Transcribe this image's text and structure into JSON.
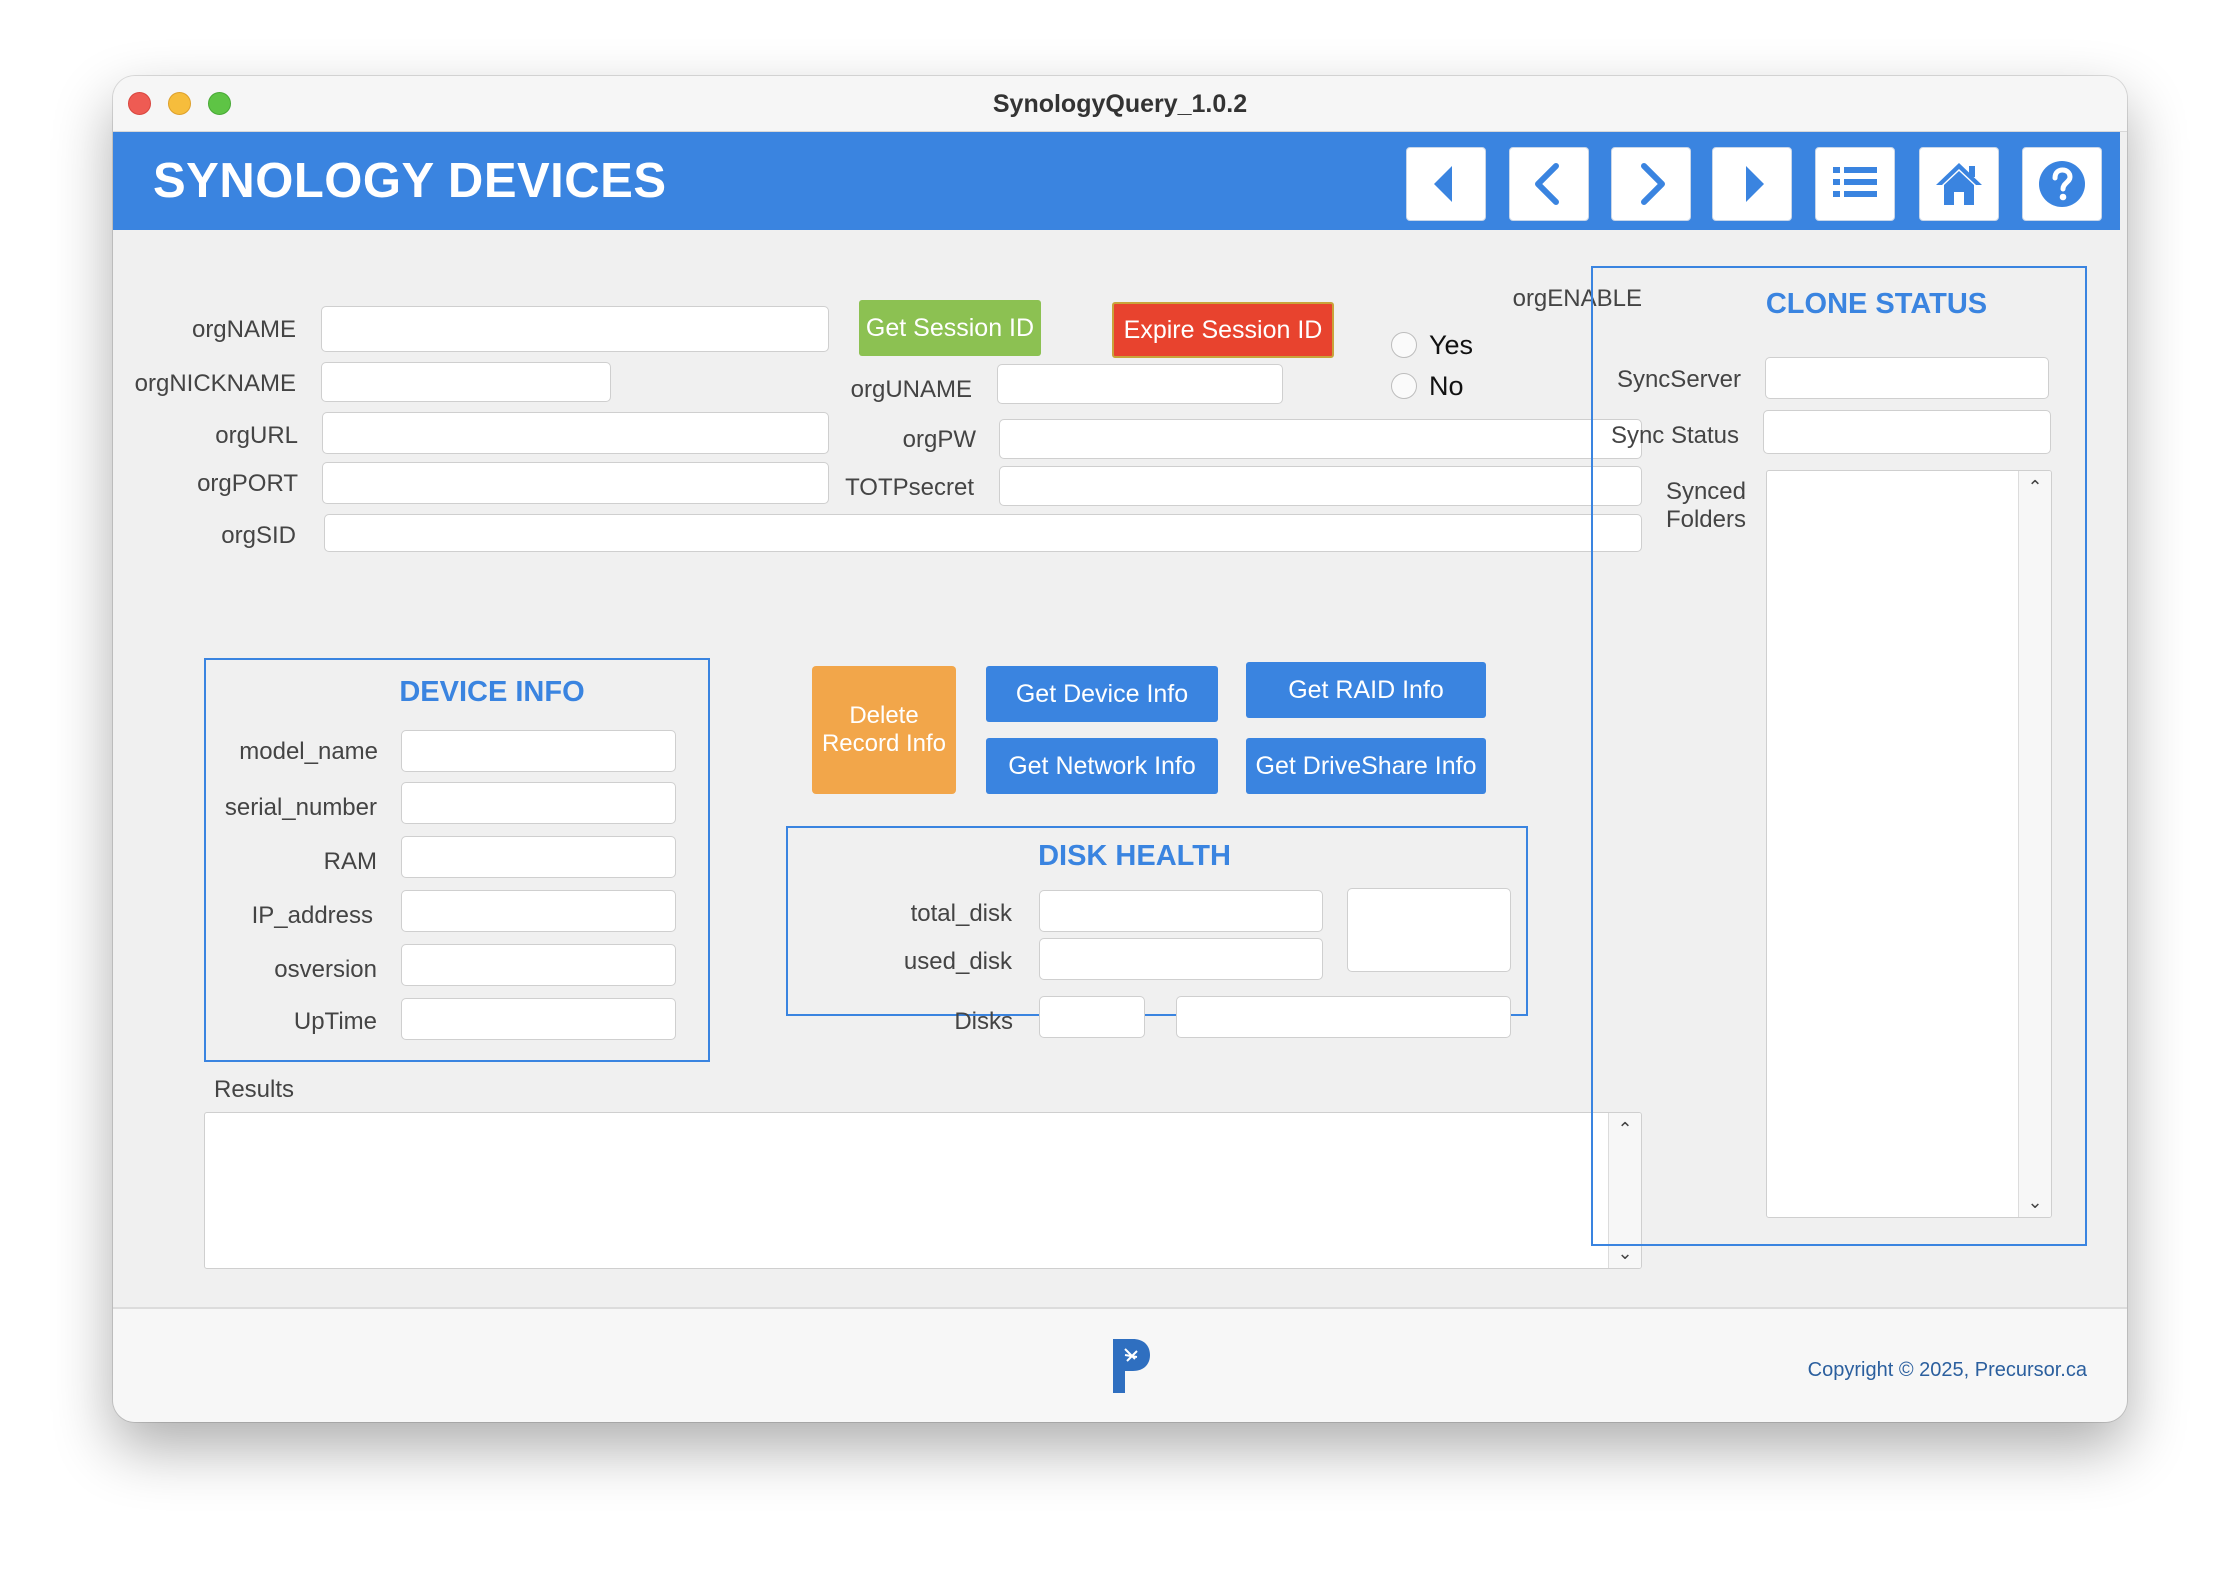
{
  "window": {
    "title": "SynologyQuery_1.0.2"
  },
  "header": {
    "title": "SYNOLOGY DEVICES",
    "nav": [
      "first-record",
      "previous-record",
      "next-record",
      "last-record",
      "list-view",
      "home",
      "help"
    ]
  },
  "org": {
    "name_label": "orgNAME",
    "nickname_label": "orgNICKNAME",
    "url_label": "orgURL",
    "port_label": "orgPORT",
    "sid_label": "orgSID",
    "uname_label": "orgUNAME",
    "pw_label": "orgPW",
    "totp_label": "TOTPsecret",
    "enable_label": "orgENABLE",
    "enable_options": [
      "Yes",
      "No"
    ]
  },
  "buttons": {
    "get_session": "Get Session ID",
    "expire_session": "Expire Session ID",
    "delete_record": "Delete Record Info",
    "get_device": "Get Device Info",
    "get_raid": "Get RAID Info",
    "get_network": "Get Network Info",
    "get_driveshare": "Get DriveShare Info"
  },
  "device_info": {
    "title": "DEVICE INFO",
    "labels": [
      "model_name",
      "serial_number",
      "RAM",
      "IP_address",
      "osversion",
      "UpTime"
    ]
  },
  "disk_health": {
    "title": "DISK HEALTH",
    "total_label": "total_disk",
    "used_label": "used_disk",
    "disks_label": "Disks"
  },
  "results": {
    "label": "Results"
  },
  "clone_status": {
    "title": "CLONE STATUS",
    "sync_server_label": "SyncServer",
    "sync_status_label": "Sync Status",
    "synced_folders_label": "Synced Folders"
  },
  "footer": {
    "copyright": "Copyright © 2025, Precursor.ca"
  },
  "colors": {
    "accent": "#3a84e0",
    "green": "#8cc152",
    "red": "#e8432e",
    "orange": "#f2a64a"
  },
  "icons": {
    "scroll_up": "⌃",
    "scroll_down": "⌄"
  }
}
